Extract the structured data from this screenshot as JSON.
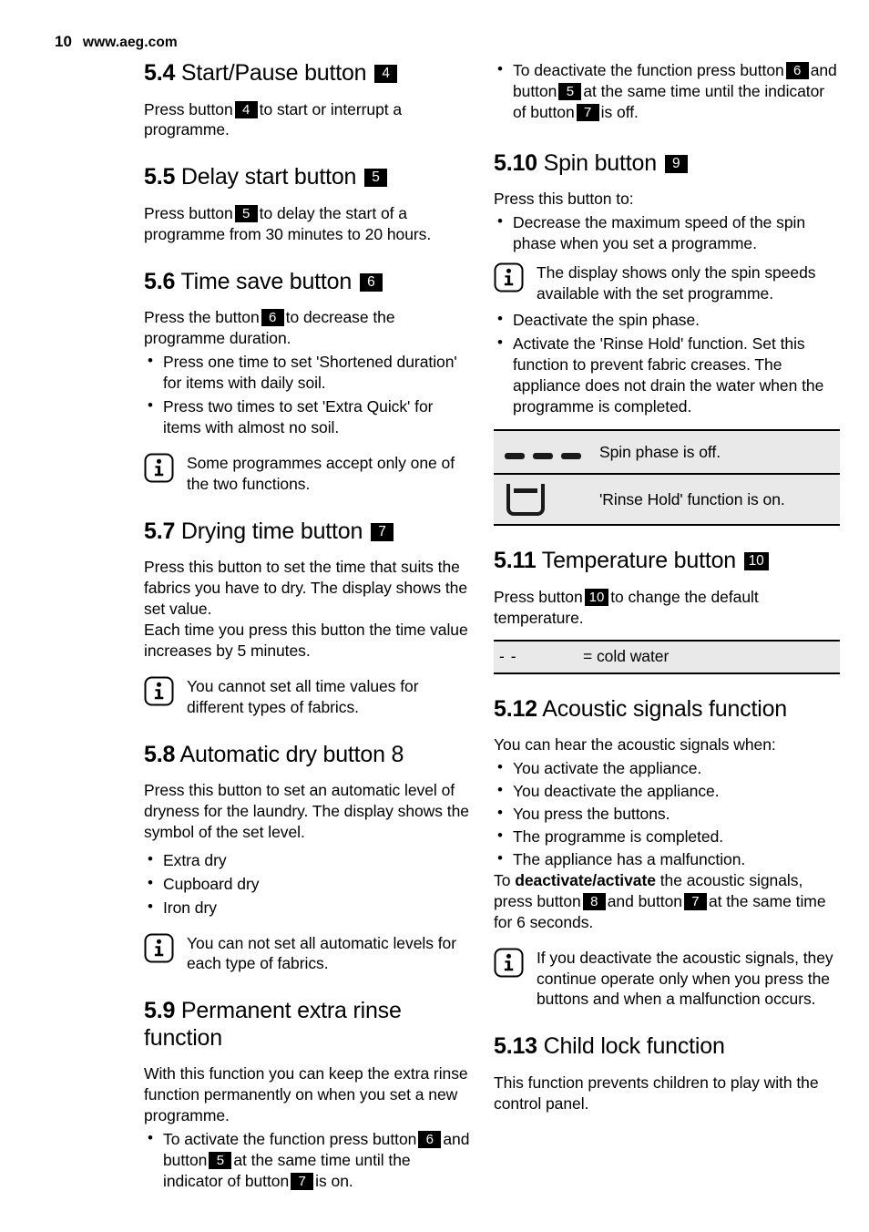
{
  "header": {
    "page_number": "10",
    "site": "www.aeg.com"
  },
  "left_column": {
    "s54": {
      "num": "5.4",
      "title": "Start/Pause button",
      "badge": "4",
      "body_1": "Press button",
      "body_badge": "4",
      "body_2": "to start or interrupt a programme."
    },
    "s55": {
      "num": "5.5",
      "title": "Delay start button",
      "badge": "5",
      "body_1": "Press button",
      "body_badge": "5",
      "body_2": "to delay the start of a programme from 30 minutes to 20 hours."
    },
    "s56": {
      "num": "5.6",
      "title": "Time save button",
      "badge": "6",
      "body_1": "Press the button",
      "body_badge": "6",
      "body_2": "to decrease the programme duration.",
      "bullets": [
        "Press one time to set 'Shortened duration' for items with daily soil.",
        "Press two times to set 'Extra Quick' for items with almost no soil."
      ],
      "note": "Some programmes accept only one of the two functions."
    },
    "s57": {
      "num": "5.7",
      "title": "Drying time button",
      "badge": "7",
      "body": "Press this button to set the time that suits the fabrics you have to dry. The display shows the set value.\nEach time you press this button the time value increases by 5 minutes.",
      "note": "You cannot set all time values for different types of fabrics."
    },
    "s58": {
      "num": "5.8",
      "title": "Automatic dry button 8",
      "body": "Press this button to set an automatic level of dryness for the laundry. The display shows the symbol of the set level.",
      "bullets": [
        "Extra dry",
        "Cupboard dry",
        "Iron dry"
      ],
      "note": "You can not set all automatic levels for each type of fabrics."
    },
    "s59": {
      "num": "5.9",
      "title": "Permanent extra rinse function",
      "body": "With this function you can keep the extra rinse function permanently on when you set a new programme.",
      "bullet_1": "To activate the function press button",
      "bullet_badge_a": "6",
      "bullet_2": "and button",
      "bullet_badge_b": "5",
      "bullet_3": "at the same time until the indicator of button",
      "bullet_badge_c": "7",
      "bullet_4": "is on."
    }
  },
  "right_column": {
    "s59_cont": {
      "bullet_1": "To deactivate the function press button",
      "bullet_badge_a": "6",
      "bullet_2": "and button",
      "bullet_badge_b": "5",
      "bullet_3": "at the same time until the indicator of button",
      "bullet_badge_c": "7",
      "bullet_4": "is off."
    },
    "s510": {
      "num": "5.10",
      "title": "Spin button",
      "badge": "9",
      "intro": "Press this button to:",
      "bullet_first": "Decrease the maximum speed of the spin phase when you set a programme.",
      "note": "The display shows only the spin speeds available with the set programme.",
      "bullets": [
        "Deactivate the spin phase.",
        "Activate the 'Rinse Hold' function. Set this function to prevent fabric creases. The appliance does not drain the water when the programme is completed."
      ],
      "symbol_table": [
        {
          "icon": "spin-off-dashes-icon",
          "text": "Spin phase is off."
        },
        {
          "icon": "rinse-hold-tub-icon",
          "text": "'Rinse Hold' function is on."
        }
      ]
    },
    "s511": {
      "num": "5.11",
      "title": "Temperature button",
      "badge": "10",
      "body_1": "Press button",
      "body_badge": "10",
      "body_2": "to change the default temperature.",
      "temp_symbol": "- -",
      "temp_text": "= cold water"
    },
    "s512": {
      "num": "5.12",
      "title": "Acoustic signals function",
      "intro": "You can hear the acoustic signals when:",
      "bullets": [
        "You activate the appliance.",
        "You deactivate the appliance.",
        "You press the buttons.",
        "The programme is completed.",
        "The appliance has a malfunction."
      ],
      "closing_1": "To",
      "closing_bold": "deactivate/activate",
      "closing_2": "the acoustic signals, press button",
      "closing_badge_a": "8",
      "closing_3": "and button",
      "closing_badge_b": "7",
      "closing_4": "at the same time for 6 seconds.",
      "note": "If you deactivate the acoustic signals, they continue operate only when you press the buttons and when a malfunction occurs."
    },
    "s513": {
      "num": "5.13",
      "title": "Child lock function",
      "body": "This function prevents children to play with the control panel."
    }
  },
  "colors": {
    "table_bg": "#e9e9e9",
    "badge_bg": "#000000",
    "text": "#000000"
  }
}
